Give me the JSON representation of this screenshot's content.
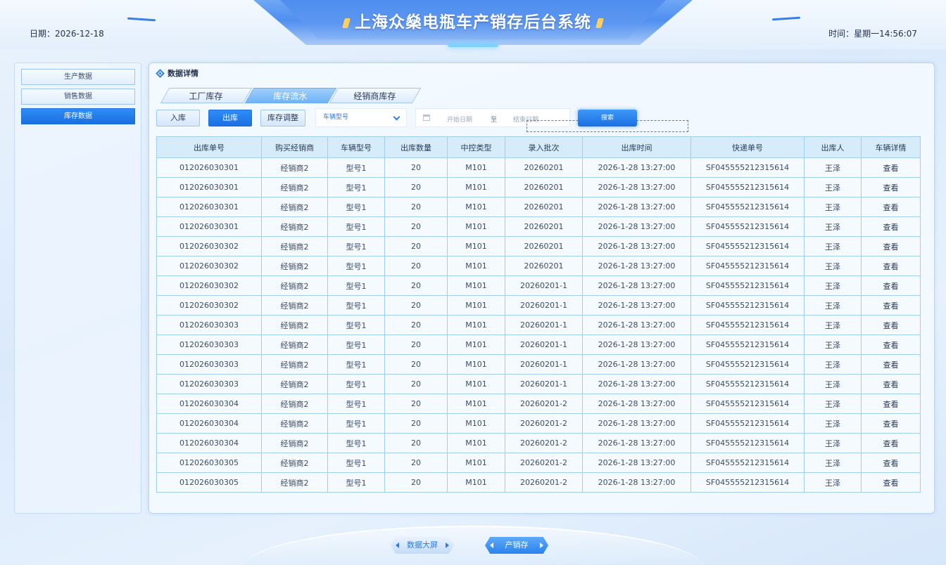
{
  "header": {
    "title": "上海众燊电瓶车产销存后台系统",
    "date": "日期：2026-12-18",
    "time": "时间：星期一14:56:07"
  },
  "sidebar": {
    "items": [
      {
        "label": "生产数据",
        "active": false
      },
      {
        "label": "销售数据",
        "active": false
      },
      {
        "label": "库存数据",
        "active": true
      }
    ]
  },
  "panel": {
    "title": "数据详情",
    "tabs": [
      {
        "label": "工厂库存",
        "active": false
      },
      {
        "label": "库存流水",
        "active": true
      },
      {
        "label": "经销商库存",
        "active": false
      }
    ],
    "buttons": {
      "in": "入库",
      "out": "出库",
      "adjust": "库存调整"
    },
    "filters": {
      "model_select": "车辆型号",
      "start_placeholder": "开始日期",
      "separator": "至",
      "end_placeholder": "结束日期",
      "search": "搜索"
    }
  },
  "table": {
    "headers": [
      "出库单号",
      "购买经销商",
      "车辆型号",
      "出库数量",
      "中控类型",
      "录入批次",
      "出库时间",
      "快递单号",
      "出库人",
      "车辆详情"
    ],
    "rows": [
      [
        "012026030301",
        "经销商2",
        "型号1",
        "20",
        "M101",
        "20260201",
        "2026-1-28  13:27:00",
        "SF045555212315614",
        "王泽",
        "查看"
      ],
      [
        "012026030301",
        "经销商2",
        "型号1",
        "20",
        "M101",
        "20260201",
        "2026-1-28  13:27:00",
        "SF045555212315614",
        "王泽",
        "查看"
      ],
      [
        "012026030301",
        "经销商2",
        "型号1",
        "20",
        "M101",
        "20260201",
        "2026-1-28  13:27:00",
        "SF045555212315614",
        "王泽",
        "查看"
      ],
      [
        "012026030301",
        "经销商2",
        "型号1",
        "20",
        "M101",
        "20260201",
        "2026-1-28  13:27:00",
        "SF045555212315614",
        "王泽",
        "查看"
      ],
      [
        "012026030302",
        "经销商2",
        "型号1",
        "20",
        "M101",
        "20260201",
        "2026-1-28  13:27:00",
        "SF045555212315614",
        "王泽",
        "查看"
      ],
      [
        "012026030302",
        "经销商2",
        "型号1",
        "20",
        "M101",
        "20260201",
        "2026-1-28  13:27:00",
        "SF045555212315614",
        "王泽",
        "查看"
      ],
      [
        "012026030302",
        "经销商2",
        "型号1",
        "20",
        "M101",
        "20260201-1",
        "2026-1-28  13:27:00",
        "SF045555212315614",
        "王泽",
        "查看"
      ],
      [
        "012026030302",
        "经销商2",
        "型号1",
        "20",
        "M101",
        "20260201-1",
        "2026-1-28  13:27:00",
        "SF045555212315614",
        "王泽",
        "查看"
      ],
      [
        "012026030303",
        "经销商2",
        "型号1",
        "20",
        "M101",
        "20260201-1",
        "2026-1-28  13:27:00",
        "SF045555212315614",
        "王泽",
        "查看"
      ],
      [
        "012026030303",
        "经销商2",
        "型号1",
        "20",
        "M101",
        "20260201-1",
        "2026-1-28  13:27:00",
        "SF045555212315614",
        "王泽",
        "查看"
      ],
      [
        "012026030303",
        "经销商2",
        "型号1",
        "20",
        "M101",
        "20260201-1",
        "2026-1-28  13:27:00",
        "SF045555212315614",
        "王泽",
        "查看"
      ],
      [
        "012026030303",
        "经销商2",
        "型号1",
        "20",
        "M101",
        "20260201-1",
        "2026-1-28  13:27:00",
        "SF045555212315614",
        "王泽",
        "查看"
      ],
      [
        "012026030304",
        "经销商2",
        "型号1",
        "20",
        "M101",
        "20260201-2",
        "2026-1-28  13:27:00",
        "SF045555212315614",
        "王泽",
        "查看"
      ],
      [
        "012026030304",
        "经销商2",
        "型号1",
        "20",
        "M101",
        "20260201-2",
        "2026-1-28  13:27:00",
        "SF045555212315614",
        "王泽",
        "查看"
      ],
      [
        "012026030304",
        "经销商2",
        "型号1",
        "20",
        "M101",
        "20260201-2",
        "2026-1-28  13:27:00",
        "SF045555212315614",
        "王泽",
        "查看"
      ],
      [
        "012026030305",
        "经销商2",
        "型号1",
        "20",
        "M101",
        "20260201-2",
        "2026-1-28  13:27:00",
        "SF045555212315614",
        "王泽",
        "查看"
      ],
      [
        "012026030305",
        "经销商2",
        "型号1",
        "20",
        "M101",
        "20260201-2",
        "2026-1-28  13:27:00",
        "SF045555212315614",
        "王泽",
        "查看"
      ]
    ]
  },
  "footer": {
    "buttons": [
      {
        "label": "数据大屏",
        "active": false
      },
      {
        "label": "产销存",
        "active": true
      }
    ]
  },
  "colors": {
    "accent": "#1a6fe2",
    "title_plate": "#4e8ff0",
    "table_border": "#9fcdee",
    "table_header_bg": "#d6ecfb"
  }
}
